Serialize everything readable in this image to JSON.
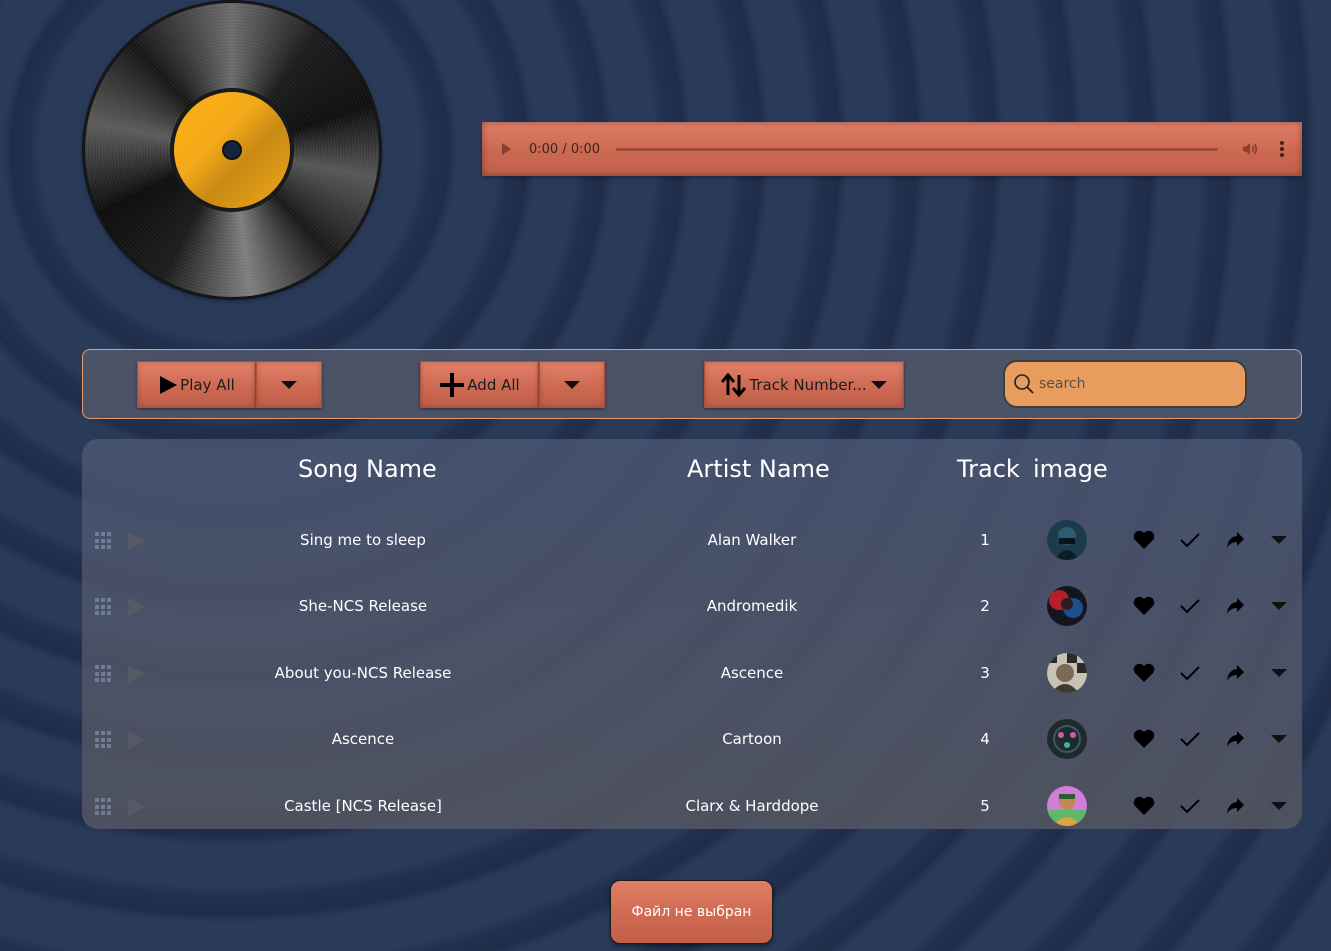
{
  "player": {
    "time": "0:00 / 0:00"
  },
  "toolbar": {
    "play_all_label": "Play All",
    "add_all_label": "Add All",
    "sort_label": "Track Number...",
    "search_placeholder": "search"
  },
  "table": {
    "headers": {
      "song": "Song Name",
      "artist": "Artist Name",
      "track": "Track",
      "image": "image"
    },
    "rows": [
      {
        "song": "Sing me to sleep",
        "artist": "Alan Walker",
        "track": "1",
        "thumb": "alan-walker-thumbnail"
      },
      {
        "song": "She-NCS Release",
        "artist": "Andromedik",
        "track": "2",
        "thumb": "andromedik-thumbnail"
      },
      {
        "song": "About you-NCS Release",
        "artist": "Ascence",
        "track": "3",
        "thumb": "ascence-thumbnail"
      },
      {
        "song": "Ascence",
        "artist": "Cartoon",
        "track": "4",
        "thumb": "cartoon-thumbnail"
      },
      {
        "song": "Castle [NCS Release]",
        "artist": "Clarx & Harddope",
        "track": "5",
        "thumb": "clarx-harddope-thumbnail"
      }
    ]
  },
  "file_input": {
    "label": "Файл не выбран"
  },
  "colors": {
    "accent": "#d06d55",
    "search_bg": "#e89c5d",
    "background": "#24344f",
    "vinyl_label": "#f2a818"
  },
  "icons": [
    "vinyl-record",
    "play-icon",
    "volume-icon",
    "more-vert-icon",
    "caret-down-icon",
    "plus-icon",
    "sort-arrows-icon",
    "search-icon",
    "drag-grip-icon",
    "heart-icon",
    "check-icon",
    "share-icon"
  ]
}
